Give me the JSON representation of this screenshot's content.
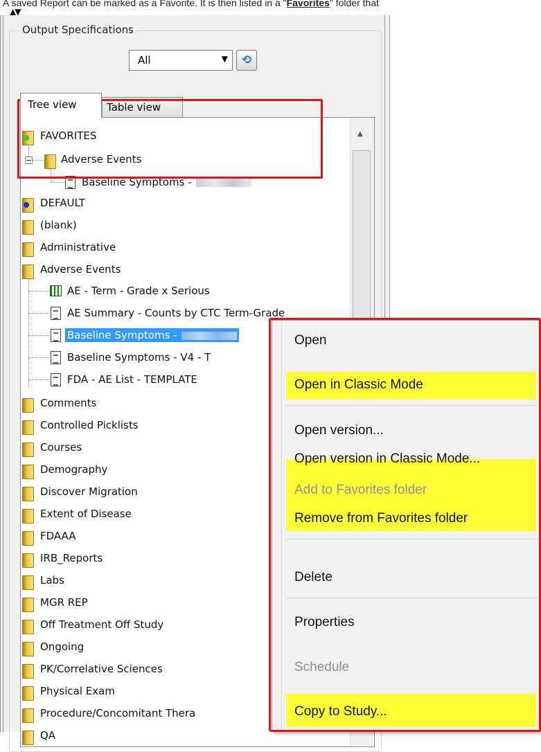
{
  "caption": {
    "prefix": "A saved Report can be marked as a Favorite. It is then listed in a \"",
    "link": "Favorites",
    "suffix": "\" folder that"
  },
  "group": {
    "title": "Output Specifications"
  },
  "filter": {
    "value": "All",
    "arrow_icon": "chevron-down-icon",
    "refresh_icon": "refresh-icon"
  },
  "tabs": [
    {
      "label": "Tree view"
    },
    {
      "label": "Table view"
    }
  ],
  "favorites": {
    "label": "FAVORITES",
    "folder": "Adverse Events",
    "report": "Baseline Symptoms -"
  },
  "tree": {
    "default": "DEFAULT",
    "folders_top": [
      "(blank)",
      "Administrative",
      "Adverse Events"
    ],
    "reports": [
      "AE - Term - Grade x Serious",
      "AE Summary - Counts by CTC Term-Grade",
      "Baseline Symptoms -",
      "Baseline Symptoms - V4 - T",
      "FDA - AE List  - TEMPLATE"
    ],
    "folders_bottom": [
      "Comments",
      "Controlled Picklists",
      "Courses",
      "Demography",
      "Discover Migration",
      "Extent of Disease",
      "FDAAA",
      "IRB_Reports",
      "Labs",
      "MGR REP",
      "Off Treatment Off Study",
      "Ongoing",
      "PK/Correlative Sciences",
      "Physical Exam",
      "Procedure/Concomitant Thera",
      "QA"
    ]
  },
  "menu": {
    "open": "Open",
    "open_classic": "Open in Classic Mode",
    "open_version": "Open version...",
    "open_version_classic": "Open version in Classic Mode...",
    "add_favorites": "Add to Favorites folder",
    "remove_favorites": "Remove from Favorites folder",
    "delete": "Delete",
    "properties": "Properties",
    "schedule": "Schedule",
    "copy_to_study": "Copy to Study..."
  },
  "colors": {
    "highlight": "#ffff35",
    "annotation_red": "#e0141c",
    "selection": "#3399ff"
  }
}
